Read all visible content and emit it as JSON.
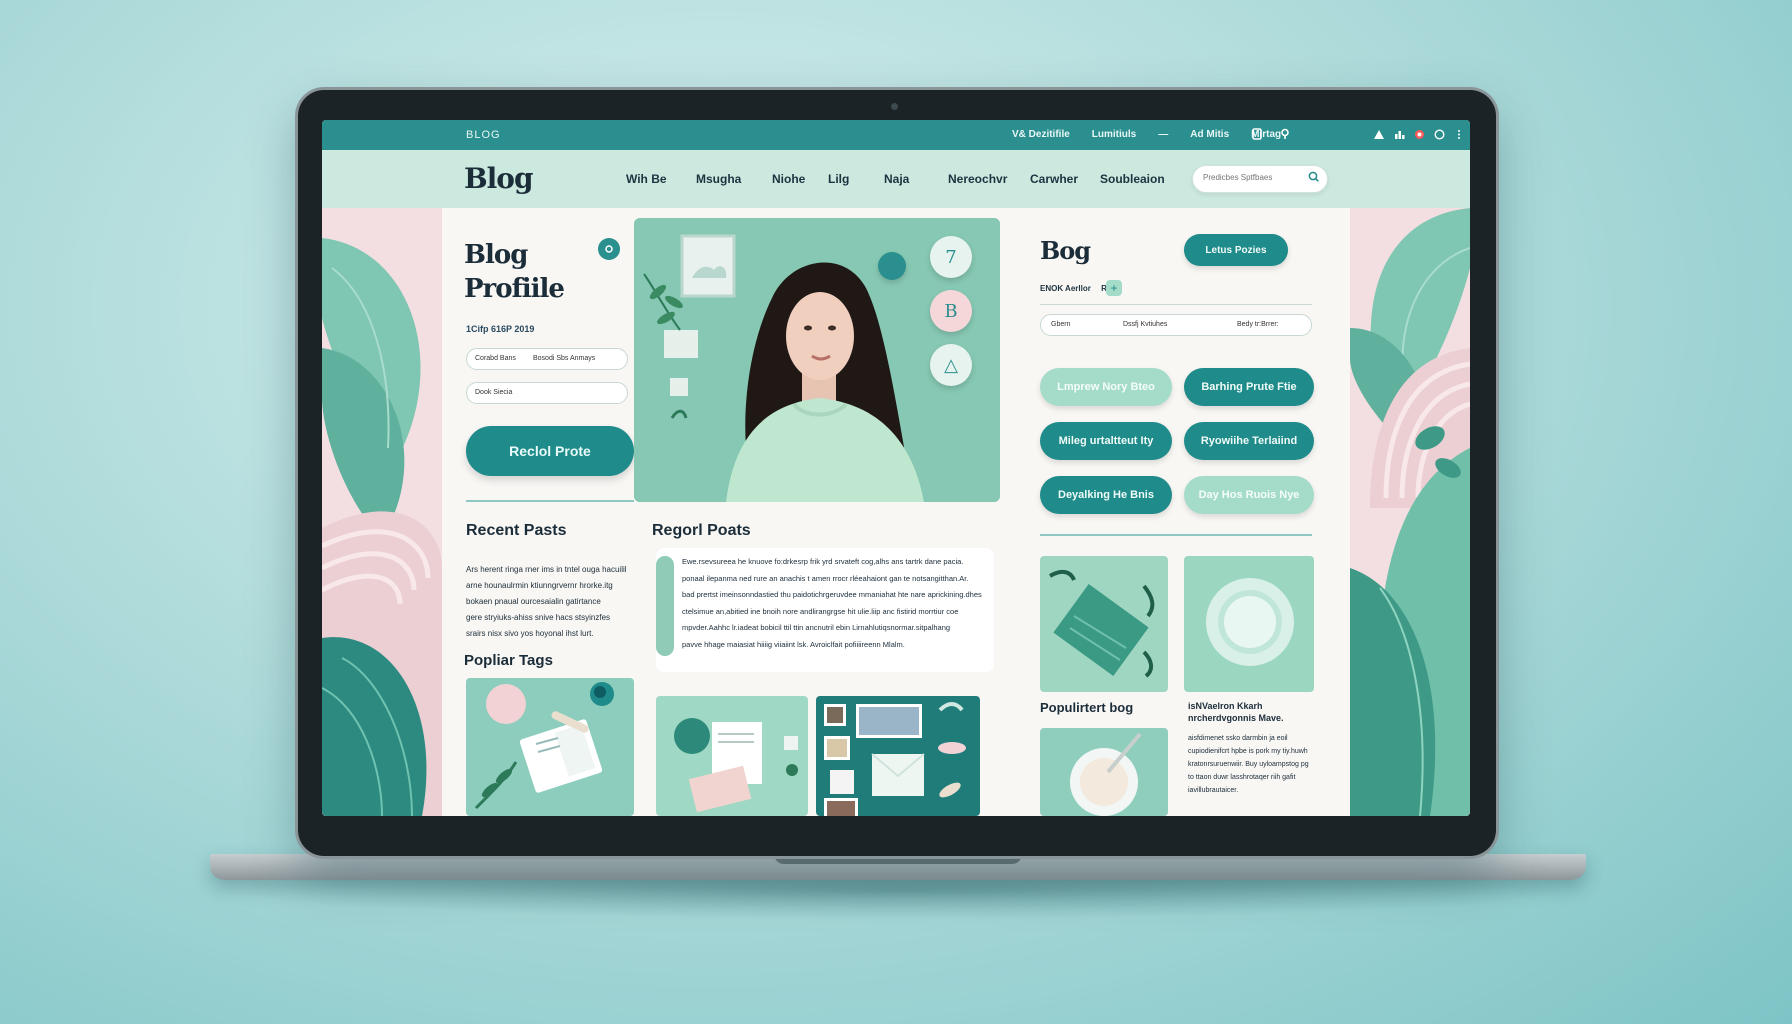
{
  "topbar": {
    "brand": "BLOG",
    "links": [
      "V& Dezitifile",
      "Lumitiuls",
      "—",
      "Ad Mitis",
      "Mirtag"
    ]
  },
  "header": {
    "logo": "Blog",
    "nav": [
      "Wih Be",
      "Msugha",
      "Niohe",
      "Lilg",
      "Naja",
      "Nereochvr",
      "Carwher",
      "Soubleaion"
    ],
    "search_placeholder": "Predicbes Sptfbaes"
  },
  "profile": {
    "title_line1": "Blog",
    "title_line2": "Profiile",
    "date": "1Cifp 616P 2019",
    "field1_a": "Corabd Bans",
    "field1_b": "Bosodi Sbs Anmays",
    "field2": "Dook Siecia",
    "cta": "Reclol Prote",
    "recent_heading": "Recent Pasts",
    "recent_lines": [
      "Ars herent ringa rner ims in tntel ouga hacuilil",
      "arne hounaulrmin ktiunngrvernr hrorke.itg",
      "bokaen pnaual ourcesaialin gatirtance",
      "gere stryiuks-ahiss snive hacs stsyinzfes",
      "srairs nisx sivo yos hoyonal ihst lurt."
    ],
    "tags_heading": "Popliar Tags"
  },
  "hero": {
    "circles": [
      "7",
      "B",
      "△"
    ]
  },
  "posts": {
    "heading": "Regorl Poats",
    "lines": [
      "Ewe.rsevsureea he knuove fo:drkesrp frik yrd srvateft cog,alhs ans tartrk dane pacia.",
      "ponaal ilepanma ned rure an anachis t amen rrocr rléeahaiont gan te notsangitthan.Ar.",
      "bad prertst imeinsonndastied thu paidotichrgeruvdee mmaniahat hte nare aprickining.dhes",
      "ctelsimue an,abitied ine bnoih nore andlirangrgse hit ulie.liip anc fistirid morrtiur coe",
      "mpvder.Aahhc lr.iadeat bobicil ttil ttin ancnutril ebin Lirnahlutiqsnormar.sitpalhang",
      "pavve hhage maiasiat hiiiig viiaiint lsk. Avroiclfait pofiiiireenn Mlalm."
    ]
  },
  "bog": {
    "title": "Bog",
    "latest_button": "Letus Pozies",
    "meta": "ENOK Aerllor",
    "meta_sub": "R",
    "field_a": "Gbern",
    "field_b": "Dssfj Kvtiuhes",
    "field_c": "Bedy tr:Brrer:",
    "pills": [
      {
        "label": "Lmprew Nory Bteo",
        "style": "light"
      },
      {
        "label": "Barhing Prute Ftie",
        "style": "dark"
      },
      {
        "label": "Mileg urtaltteut Ity",
        "style": "dark"
      },
      {
        "label": "Ryowiihe Terlaiind",
        "style": "dark"
      },
      {
        "label": "Deyalking He Bnis",
        "style": "dark"
      },
      {
        "label": "Day Hos Ruois Nye",
        "style": "light"
      }
    ],
    "popular_blog": "Populirtert bog",
    "article_title": "isNVaelron Kkarh nrcherdvgonnis Mave.",
    "article_body": "aisfdimenet ssko darmbin ja eoil cupiodienifcrt hpbe is pork my tiy.huwh kratonrsuruenwiir. Buy uyloampstog pg to ttaon duwr lasshrotaqer riih gafit iavillubrautaicer."
  },
  "colors": {
    "accent": "#1f8b8a",
    "mint": "#a5dcc9",
    "blush": "#f3dfe1",
    "ink": "#1c2d3a"
  }
}
